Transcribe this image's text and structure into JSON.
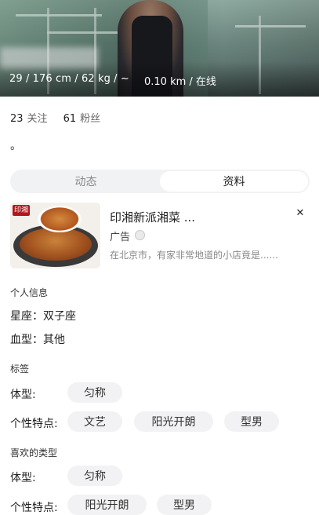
{
  "profile": {
    "stats": "29 / 176 cm / 62 kg / ~",
    "distance": "0.10 km / 在线",
    "following_count": "23",
    "following_label": "关注",
    "followers_count": "61",
    "followers_label": "粉丝",
    "bio": "。"
  },
  "tabs": [
    {
      "label": "动态",
      "active": false
    },
    {
      "label": "资料",
      "active": true
    }
  ],
  "ad": {
    "title": "印湘新派湘菜 ...",
    "label": "广告",
    "description": "在北京市，有家非常地道的小店竟是......",
    "brand_mark": "印湘"
  },
  "personal_info": {
    "title": "个人信息",
    "zodiac": "星座：双子座",
    "blood_type": "血型：其他"
  },
  "tags": {
    "title": "标签",
    "body_label": "体型:",
    "body_values": [
      "匀称"
    ],
    "personality_label": "个性特点:",
    "personality_values": [
      "文艺",
      "阳光开朗",
      "型男"
    ]
  },
  "preferences": {
    "title": "喜欢的类型",
    "body_label": "体型:",
    "body_values": [
      "匀称"
    ],
    "personality_label": "个性特点:",
    "personality_values": [
      "阳光开朗",
      "型男"
    ]
  }
}
